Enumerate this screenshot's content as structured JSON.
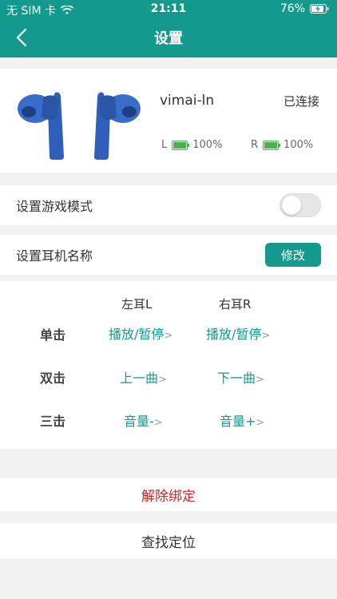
{
  "status": {
    "carrier": "无 SIM 卡",
    "time": "21:11",
    "battery_percent": "76%"
  },
  "nav": {
    "title": "设置",
    "back_icon": "chevron-left-icon"
  },
  "device": {
    "name": "vimai-ln",
    "connection": "已连接",
    "left_label": "L",
    "left_battery": "100%",
    "right_label": "R",
    "right_battery": "100%",
    "battery_color": "#4caf50"
  },
  "settings": {
    "game_mode_label": "设置游戏模式",
    "game_mode_enabled": false,
    "name_label": "设置耳机名称",
    "edit_button": "修改"
  },
  "controls": {
    "left_header": "左耳L",
    "right_header": "右耳R",
    "rows": [
      {
        "label": "单击",
        "left": "播放/暂停",
        "right": "播放/暂停"
      },
      {
        "label": "双击",
        "left": "上一曲",
        "right": "下一曲"
      },
      {
        "label": "三击",
        "left": "音量-",
        "right": "音量+"
      }
    ]
  },
  "actions": {
    "unbind": "解除绑定",
    "locate": "查找定位"
  },
  "colors": {
    "accent": "#149a8c",
    "danger": "#e02020"
  }
}
